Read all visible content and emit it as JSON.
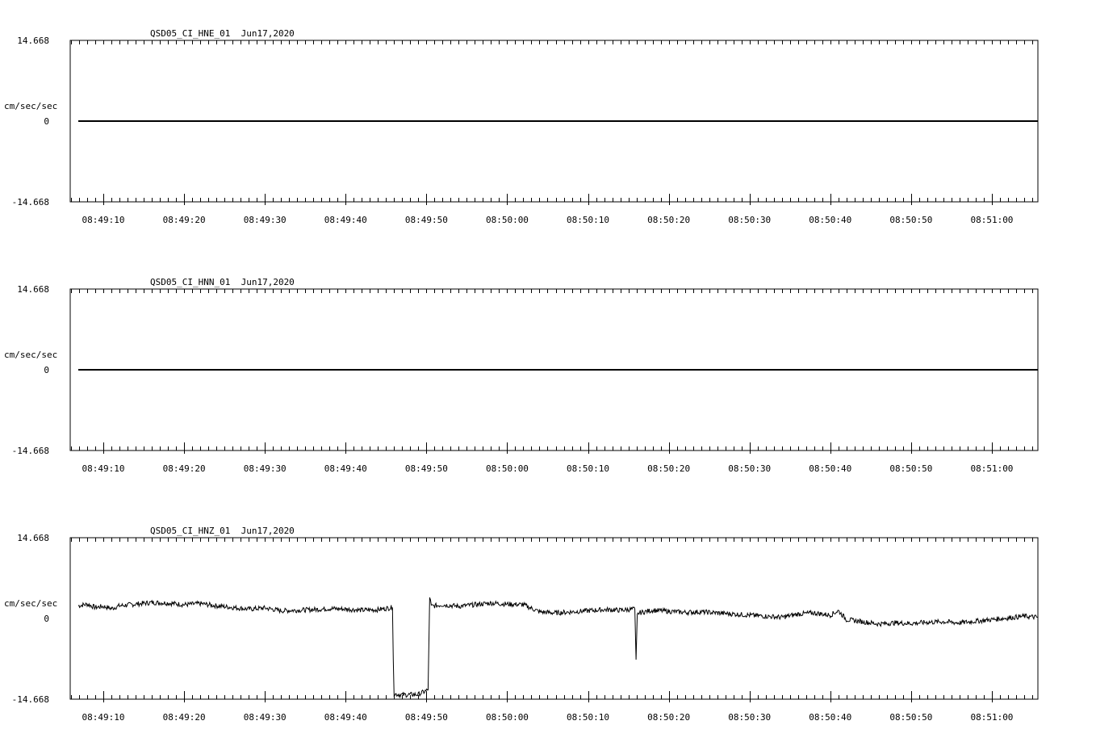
{
  "chart_data": [
    {
      "type": "line",
      "title": "QSD05_CI_HNE_01  Jun17,2020",
      "ylabel": "cm/sec/sec",
      "ylim": [
        -14.668,
        14.668
      ],
      "yticks": [
        "14.668",
        "0",
        "-14.668"
      ],
      "xlim_seconds": [
        5.9,
        125.7
      ],
      "xtick_labels": [
        "08:49:10",
        "08:49:20",
        "08:49:30",
        "08:49:40",
        "08:49:50",
        "08:50:00",
        "08:50:10",
        "08:50:20",
        "08:50:30",
        "08:50:40",
        "08:50:50",
        "08:51:00"
      ],
      "series": [
        {
          "x": [
            6.9,
            125.7
          ],
          "y": [
            0.0,
            0.0
          ]
        }
      ]
    },
    {
      "type": "line",
      "title": "QSD05_CI_HNN_01  Jun17,2020",
      "ylabel": "cm/sec/sec",
      "ylim": [
        -14.668,
        14.668
      ],
      "yticks": [
        "14.668",
        "0",
        "-14.668"
      ],
      "xlim_seconds": [
        5.9,
        125.7
      ],
      "xtick_labels": [
        "08:49:10",
        "08:49:20",
        "08:49:30",
        "08:49:40",
        "08:49:50",
        "08:50:00",
        "08:50:10",
        "08:50:20",
        "08:50:30",
        "08:50:40",
        "08:50:50",
        "08:51:00"
      ],
      "series": [
        {
          "x": [
            6.9,
            125.7
          ],
          "y": [
            0.0,
            0.0
          ]
        }
      ]
    },
    {
      "type": "line",
      "title": "QSD05_CI_HNZ_01  Jun17,2020",
      "ylabel": "cm/sec/sec",
      "ylim": [
        -14.668,
        14.668
      ],
      "yticks": [
        "14.668",
        "0",
        "-14.668"
      ],
      "xlim_seconds": [
        5.9,
        125.7
      ],
      "xtick_labels": [
        "08:49:10",
        "08:49:20",
        "08:49:30",
        "08:49:40",
        "08:49:50",
        "08:50:00",
        "08:50:10",
        "08:50:20",
        "08:50:30",
        "08:50:40",
        "08:50:50",
        "08:51:00"
      ],
      "series": [
        {
          "x": [
            6.9,
            8.0,
            9.0,
            10.0,
            11.0,
            12.0,
            14.0,
            16.0,
            18.0,
            20.0,
            22.0,
            24.0,
            26.0,
            28.0,
            30.0,
            32.0,
            34.0,
            36.0,
            38.0,
            40.0,
            42.0,
            44.0,
            45.8,
            45.9,
            46.0,
            47.0,
            49.0,
            50.2,
            50.4,
            50.6,
            52.0,
            54.0,
            56.0,
            58.0,
            60.0,
            62.0,
            64.0,
            66.0,
            68.0,
            70.0,
            72.0,
            74.0,
            75.8,
            75.95,
            76.1,
            76.3,
            78.0,
            80.0,
            82.0,
            84.0,
            86.0,
            88.0,
            90.0,
            92.0,
            94.0,
            96.0,
            98.0,
            100.0,
            101.0,
            102.0,
            104.0,
            106.0,
            108.0,
            110.0,
            112.0,
            114.0,
            116.0,
            118.0,
            120.0,
            122.0,
            124.0,
            125.7
          ],
          "y": [
            2.3,
            2.6,
            2.0,
            2.2,
            1.8,
            2.3,
            2.6,
            2.9,
            2.8,
            2.5,
            2.7,
            2.3,
            2.0,
            1.7,
            1.9,
            1.4,
            1.5,
            1.6,
            1.8,
            1.7,
            1.5,
            1.6,
            2.0,
            -7.5,
            -13.7,
            -13.9,
            -13.8,
            -13.0,
            4.0,
            2.2,
            2.5,
            2.2,
            2.5,
            2.8,
            2.6,
            2.5,
            1.2,
            1.0,
            1.2,
            1.4,
            1.6,
            1.5,
            1.7,
            -7.5,
            0.5,
            1.0,
            1.5,
            1.3,
            1.1,
            1.2,
            1.0,
            0.8,
            0.6,
            0.4,
            0.2,
            0.8,
            1.0,
            0.6,
            1.4,
            -0.2,
            -0.6,
            -1.0,
            -0.8,
            -0.9,
            -0.7,
            -0.6,
            -0.8,
            -0.5,
            -0.2,
            0.1,
            0.4,
            0.2
          ]
        }
      ]
    }
  ]
}
